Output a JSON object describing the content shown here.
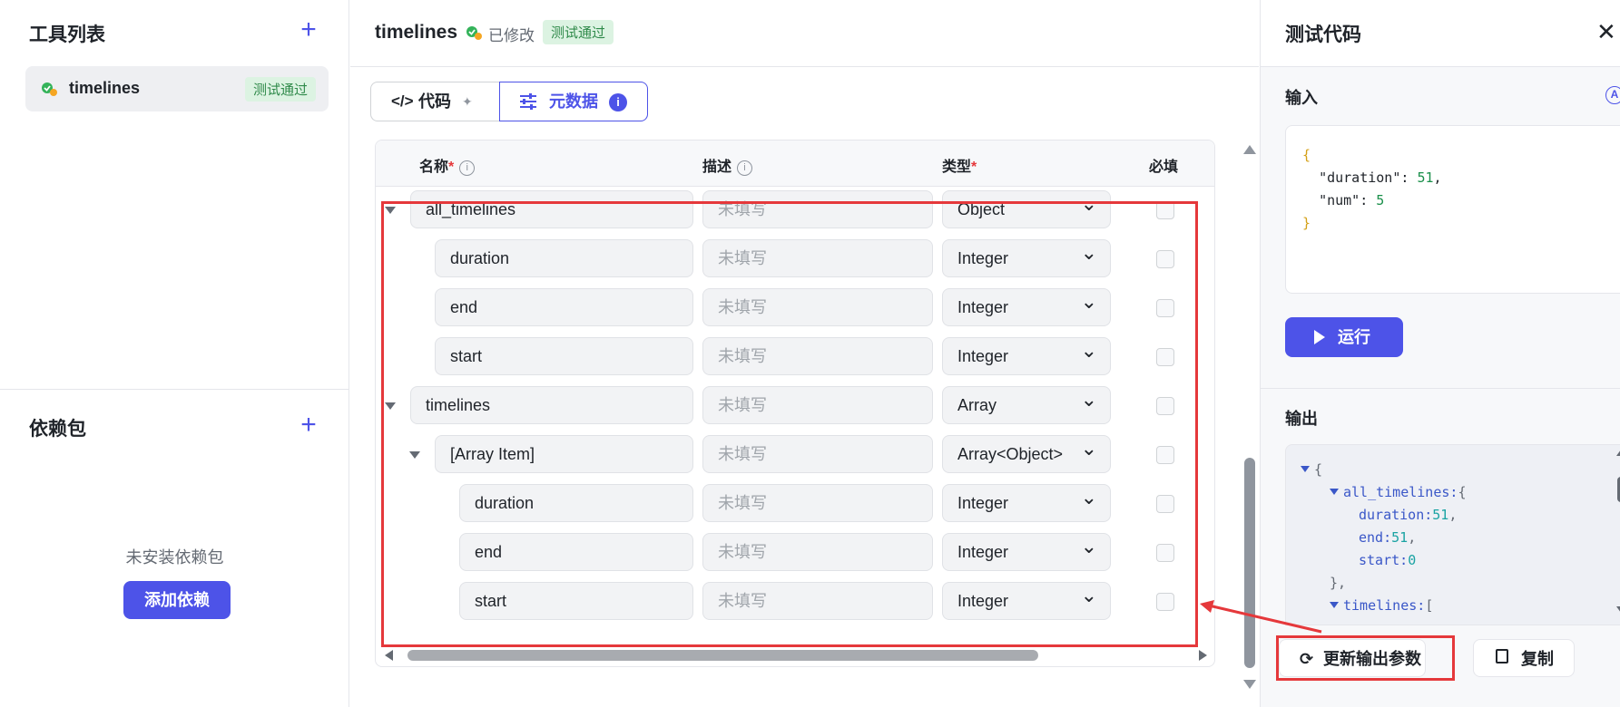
{
  "sidebar": {
    "tools_title": "工具列表",
    "tool_item": {
      "name": "timelines",
      "badge": "测试通过"
    },
    "deps_title": "依赖包",
    "deps_empty": "未安装依赖包",
    "add_dep_label": "添加依赖"
  },
  "main": {
    "title": "timelines",
    "modified_text": "已修改",
    "badge": "测试通过",
    "tabs": [
      {
        "label": "代码"
      },
      {
        "label": "元数据"
      }
    ],
    "columns": {
      "name": "名称",
      "desc": "描述",
      "type": "类型",
      "required": "必填",
      "req_mark": "*"
    },
    "rows": [
      {
        "name": "all_timelines",
        "desc": "未填写",
        "type": "Object",
        "depth": 0,
        "expandable": true
      },
      {
        "name": "duration",
        "desc": "未填写",
        "type": "Integer",
        "depth": 1,
        "expandable": false
      },
      {
        "name": "end",
        "desc": "未填写",
        "type": "Integer",
        "depth": 1,
        "expandable": false
      },
      {
        "name": "start",
        "desc": "未填写",
        "type": "Integer",
        "depth": 1,
        "expandable": false
      },
      {
        "name": "timelines",
        "desc": "未填写",
        "type": "Array",
        "depth": 0,
        "expandable": true
      },
      {
        "name": "[Array Item]",
        "desc": "未填写",
        "type": "Array<Object>",
        "depth": 1,
        "expandable": true
      },
      {
        "name": "duration",
        "desc": "未填写",
        "type": "Integer",
        "depth": 2,
        "expandable": false
      },
      {
        "name": "end",
        "desc": "未填写",
        "type": "Integer",
        "depth": 2,
        "expandable": false
      },
      {
        "name": "start",
        "desc": "未填写",
        "type": "Integer",
        "depth": 2,
        "expandable": false
      }
    ]
  },
  "test_panel": {
    "title": "测试代码",
    "input_label": "输入",
    "input_json": {
      "open": "{",
      "line1_key": "\"duration\"",
      "line1_val": "51",
      "line2_key": "\"num\"",
      "line2_val": "5",
      "close": "}"
    },
    "run_label": "运行",
    "output_label": "输出",
    "output_tree": {
      "root_open": "{",
      "k_all": "all_timelines:",
      "all_open": "{",
      "k_duration": "duration:",
      "v_duration": "51",
      "k_end": "end:",
      "v_end": "51",
      "k_start": "start:",
      "v_start": "0",
      "all_close": "},",
      "k_timelines": "timelines:",
      "tl_open": "["
    },
    "update_label": "更新输出参数",
    "copy_label": "复制"
  },
  "colors": {
    "accent": "#4d53e8",
    "success_bg": "#dcf3e2",
    "success_text": "#2f8a4a",
    "annotation": "#e5383b"
  }
}
